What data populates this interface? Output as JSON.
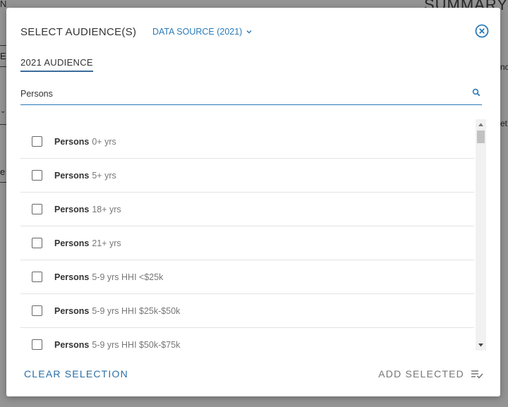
{
  "background": {
    "summary_heading": "SUMMARY",
    "frag_n": "N",
    "frag_e": "E",
    "frag_e2": "e",
    "frag_nc": "nc",
    "frag_et": "et"
  },
  "modal": {
    "title": "SELECT AUDIENCE(S)",
    "data_source": "DATA SOURCE (2021)",
    "tab_label": "2021 AUDIENCE",
    "search": {
      "value": "Persons",
      "placeholder": ""
    },
    "rows": [
      {
        "bold": "Persons",
        "rest": "0+ yrs"
      },
      {
        "bold": "Persons",
        "rest": "5+ yrs"
      },
      {
        "bold": "Persons",
        "rest": "18+ yrs"
      },
      {
        "bold": "Persons",
        "rest": "21+ yrs"
      },
      {
        "bold": "Persons",
        "rest": "5-9 yrs HHI <$25k"
      },
      {
        "bold": "Persons",
        "rest": "5-9 yrs HHI $25k-$50k"
      },
      {
        "bold": "Persons",
        "rest": "5-9 yrs HHI $50k-$75k"
      }
    ],
    "clear_label": "CLEAR SELECTION",
    "add_label": "ADD SELECTED"
  },
  "icons": {
    "close": "close-circle-icon",
    "chevron": "chevron-down-icon",
    "search": "search-icon",
    "add": "playlist-check-icon"
  },
  "colors": {
    "accent": "#2a7ab8",
    "tab_underline": "#3a6b9a",
    "muted_text": "#777777"
  }
}
